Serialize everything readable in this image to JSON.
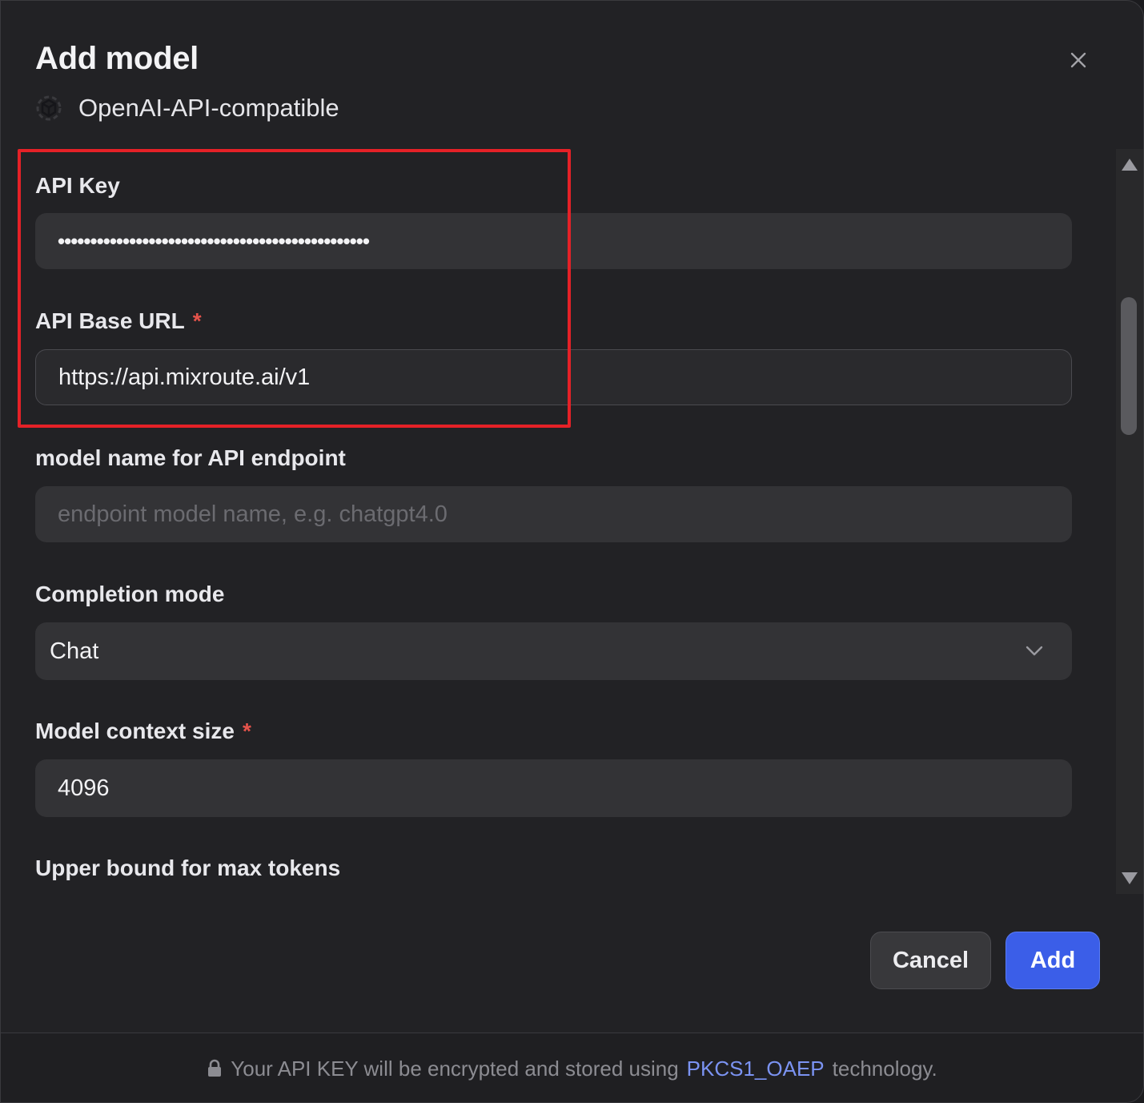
{
  "dialog": {
    "title": "Add model",
    "provider_name": "OpenAI-API-compatible"
  },
  "fields": {
    "api_key": {
      "label": "API Key",
      "masked_value": "••••••••••••••••••••••••••••••••••••••••••••••••"
    },
    "api_base_url": {
      "label": "API Base URL",
      "required_mark": "*",
      "value": "https://api.mixroute.ai/v1"
    },
    "endpoint_model_name": {
      "label": "model name for API endpoint",
      "placeholder": "endpoint model name, e.g. chatgpt4.0"
    },
    "completion_mode": {
      "label": "Completion mode",
      "selected": "Chat"
    },
    "context_size": {
      "label": "Model context size",
      "required_mark": "*",
      "value": "4096"
    },
    "max_tokens": {
      "label": "Upper bound for max tokens"
    }
  },
  "buttons": {
    "cancel": "Cancel",
    "add": "Add"
  },
  "footer": {
    "text_before": "Your API KEY will be encrypted and stored using",
    "link_text": "PKCS1_OAEP",
    "text_after": "technology."
  },
  "colors": {
    "accent": "#3b5ee8",
    "highlight_box": "#e52127",
    "required": "#e5534b",
    "link": "#7b93f2"
  },
  "icons": {
    "close": "close-icon",
    "provider": "cube-icon",
    "dropdown": "chevron-down-icon",
    "lock": "lock-icon",
    "scroll_up": "triangle-up-icon",
    "scroll_down": "triangle-down-icon"
  }
}
